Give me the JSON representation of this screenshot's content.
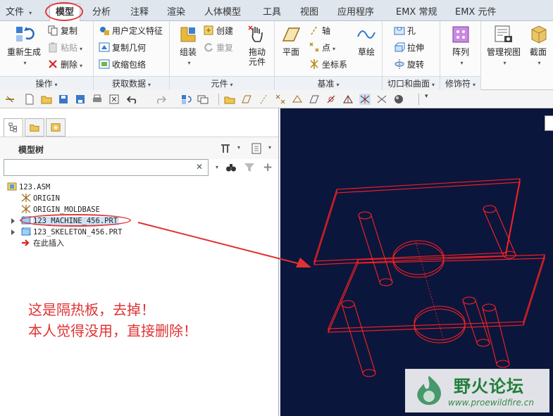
{
  "tabs": [
    {
      "label": "文件",
      "caret": "▾"
    },
    {
      "label": "模型",
      "active": true
    },
    {
      "label": "分析"
    },
    {
      "label": "注释"
    },
    {
      "label": "渲染"
    },
    {
      "label": "人体模型"
    },
    {
      "label": "工具"
    },
    {
      "label": "视图"
    },
    {
      "label": "应用程序"
    },
    {
      "label": "EMX 常规"
    },
    {
      "label": "EMX 元件"
    }
  ],
  "ribbon": {
    "operations": {
      "label": "操作",
      "regenerate": "重新生成",
      "copy": "复制",
      "paste": "粘贴",
      "delete": "删除"
    },
    "get_data": {
      "label": "获取数据",
      "udf": "用户定义特征",
      "copy_geometry": "复制几何",
      "shrinkwrap": "收缩包络"
    },
    "component": {
      "label": "元件",
      "assemble": "组装",
      "create": "创建",
      "repeat": "重复",
      "drag": "拖动",
      "drag2": "元件"
    },
    "datum": {
      "label": "基准",
      "plane": "平面",
      "axis": "轴",
      "point": "点",
      "csys": "坐标系",
      "sketch": "草绘"
    },
    "cut_surface": {
      "label": "切口和曲面",
      "hole": "孔",
      "extrude": "拉伸",
      "revolve": "旋转"
    },
    "modifiers": {
      "label": "修饰符",
      "pattern": "阵列"
    },
    "model_display": {
      "manage_views": "管理视图",
      "section": "截面"
    }
  },
  "model_tree": {
    "title": "模型树",
    "filter_placeholder": "",
    "items": [
      {
        "label": "123.ASM",
        "type": "assembly"
      },
      {
        "label": "ORIGIN",
        "type": "csys"
      },
      {
        "label": "ORIGIN_MOLDBASE",
        "type": "csys"
      },
      {
        "label": "123_MACHINE_456.PRT",
        "type": "part",
        "highlighted": true
      },
      {
        "label": "123_SKELETON_456.PRT",
        "type": "part"
      },
      {
        "label": "在此插入",
        "type": "insert-here"
      }
    ]
  },
  "annotation": {
    "line1": "这是隔热板，去掉！",
    "line2": "本人觉得没用，直接删除！"
  },
  "watermark": {
    "title": "野火论坛",
    "url": "www.proewildfire.cn"
  },
  "colors": {
    "viewport_bg": "#0b163d",
    "wireframe": "#ff2020",
    "annotation": "#e03232",
    "highlight_circle": "#e23b3b"
  }
}
